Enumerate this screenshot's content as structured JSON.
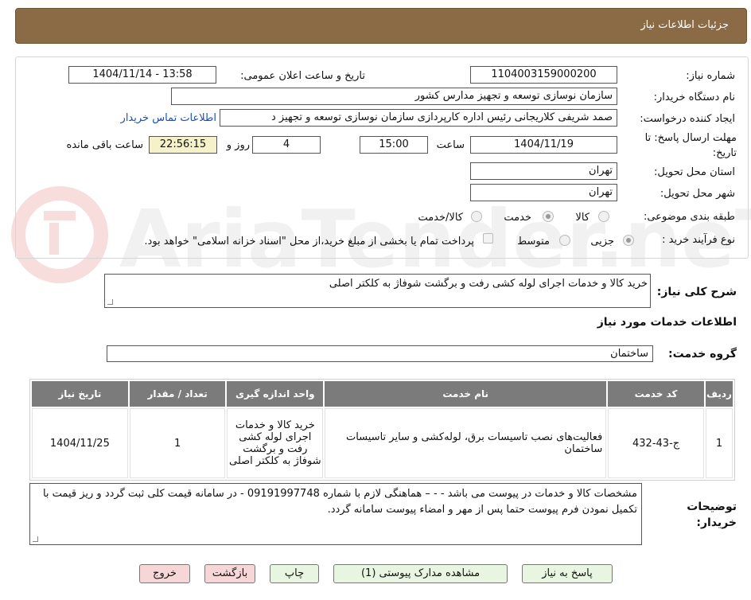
{
  "header": {
    "title": "جزئیات اطلاعات نیاز"
  },
  "form": {
    "need_number": {
      "label": "شماره نیاز:",
      "value": "1104003159000200"
    },
    "announce_datetime": {
      "label": "تاریخ و ساعت اعلان عمومی:",
      "value": "1404/11/14 - 13:58"
    },
    "buyer_org": {
      "label": "نام دستگاه خریدار:",
      "value": "سازمان نوسازی  توسعه و تجهیز مدارس کشور"
    },
    "requester": {
      "label": "ایجاد کننده درخواست:",
      "value": "صمد شریفی کلاریجانی رئیس اداره کارپردازی سازمان نوسازی  توسعه و تجهیز د",
      "contact_link": "اطلاعات تماس خریدار"
    },
    "deadline": {
      "label": "مهلت ارسال پاسخ: تا تاریخ:",
      "date": "1404/11/19",
      "time_label": "ساعت",
      "time": "15:00",
      "days": "4",
      "days_label": "روز و",
      "remaining": "22:56:15",
      "remaining_label": "ساعت باقی مانده"
    },
    "province": {
      "label": "استان محل تحویل:",
      "value": "تهران"
    },
    "city": {
      "label": "شهر محل تحویل:",
      "value": "تهران"
    },
    "category": {
      "label": "طبقه بندی موضوعی:",
      "options": [
        "کالا",
        "خدمت",
        "کالا/خدمت"
      ],
      "selected": "خدمت"
    },
    "purchase_type": {
      "label": "نوع فرآیند خرید :",
      "options": [
        "جزیی",
        "متوسط"
      ],
      "selected": "جزیی",
      "treasury_note": "پرداخت تمام یا بخشی از مبلغ خرید،از محل \"اسناد خزانه اسلامی\" خواهد بود."
    }
  },
  "description": {
    "label": "شرح کلی نیاز:",
    "value": "خرید کالا و خدمات اجرای لوله کشی رفت و برگشت شوفاژ به کلکتر اصلی"
  },
  "services_section": {
    "title": "اطلاعات خدمات مورد نیاز"
  },
  "service_group": {
    "label": "گروه خدمت:",
    "value": "ساختمان"
  },
  "table": {
    "headers": [
      "ردیف",
      "کد خدمت",
      "نام خدمت",
      "واحد اندازه گیری",
      "تعداد / مقدار",
      "تاریخ نیاز"
    ],
    "rows": [
      [
        "1",
        "ج-43-432",
        "فعالیت‌های نصب تاسیسات برق، لوله‌کشی و سایر تاسیسات ساختمان",
        "خرید کالا و خدمات اجرای لوله کشی رفت و برگشت شوفاژ به کلکتر اصلی",
        "1",
        "1404/11/25"
      ]
    ]
  },
  "buyer_notes": {
    "label": "توضیحات خریدار:",
    "value": "مشخصات کالا و خدمات در پیوست می باشد - - – هماهنگی لازم با شماره 09191997748 - در سامانه قیمت کلی ثبت گردد و ریز قیمت با تکمیل نمودن فرم پیوست حتما پس از مهر و امضاء پیوست سامانه گردد."
  },
  "buttons": {
    "reply": "پاسخ به نیاز",
    "attachments": "مشاهده مدارک پیوستی (1)",
    "print": "چاپ",
    "back": "بازگشت",
    "exit": "خروج"
  },
  "watermark": {
    "text": "AriaTender.neT"
  },
  "colors": {
    "header_bg": "#8b6a46",
    "table_header_bg": "#7b7b7b",
    "button_green": "#e8f5e0",
    "button_red": "#f6d6d6",
    "remaining_bg": "#f5f1c9",
    "link": "#1b4fb4"
  }
}
